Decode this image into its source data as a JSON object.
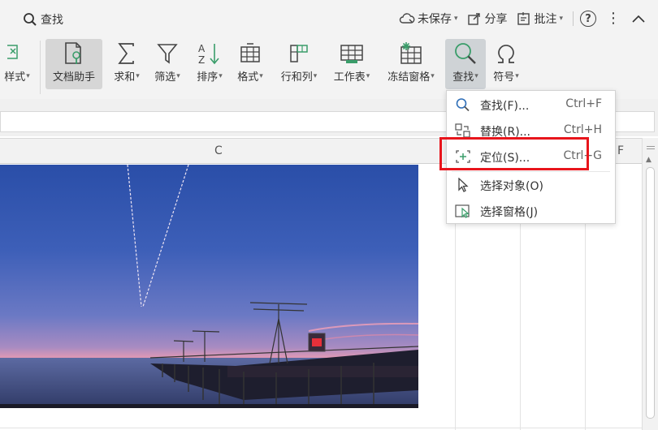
{
  "topbar": {
    "search_label": "查找",
    "unsaved_label": "未保存",
    "share_label": "分享",
    "annotate_label": "批注"
  },
  "ribbon": {
    "style_label": "样式",
    "doc_assistant_label": "文档助手",
    "sum_label": "求和",
    "filter_label": "筛选",
    "sort_label": "排序",
    "format_label": "格式",
    "rowcol_label": "行和列",
    "worksheet_label": "工作表",
    "freeze_label": "冻结窗格",
    "find_label": "查找",
    "symbol_label": "符号"
  },
  "sheet": {
    "col_c": "C",
    "col_f": "F"
  },
  "find_menu": {
    "items": [
      {
        "label": "查找(F)...",
        "shortcut": "Ctrl+F",
        "icon": "magnifier-icon"
      },
      {
        "label": "替换(R)...",
        "shortcut": "Ctrl+H",
        "icon": "replace-icon"
      },
      {
        "label": "定位(S)...",
        "shortcut": "Ctrl+G",
        "icon": "locate-icon"
      },
      {
        "label": "选择对象(O)",
        "shortcut": "",
        "icon": "cursor-icon"
      },
      {
        "label": "选择窗格(J)",
        "shortcut": "",
        "icon": "selection-pane-icon"
      }
    ]
  },
  "colors": {
    "accent_green": "#3a9d6a",
    "highlight_red": "#e8151c",
    "ribbon_bg": "#f3f3f3"
  }
}
